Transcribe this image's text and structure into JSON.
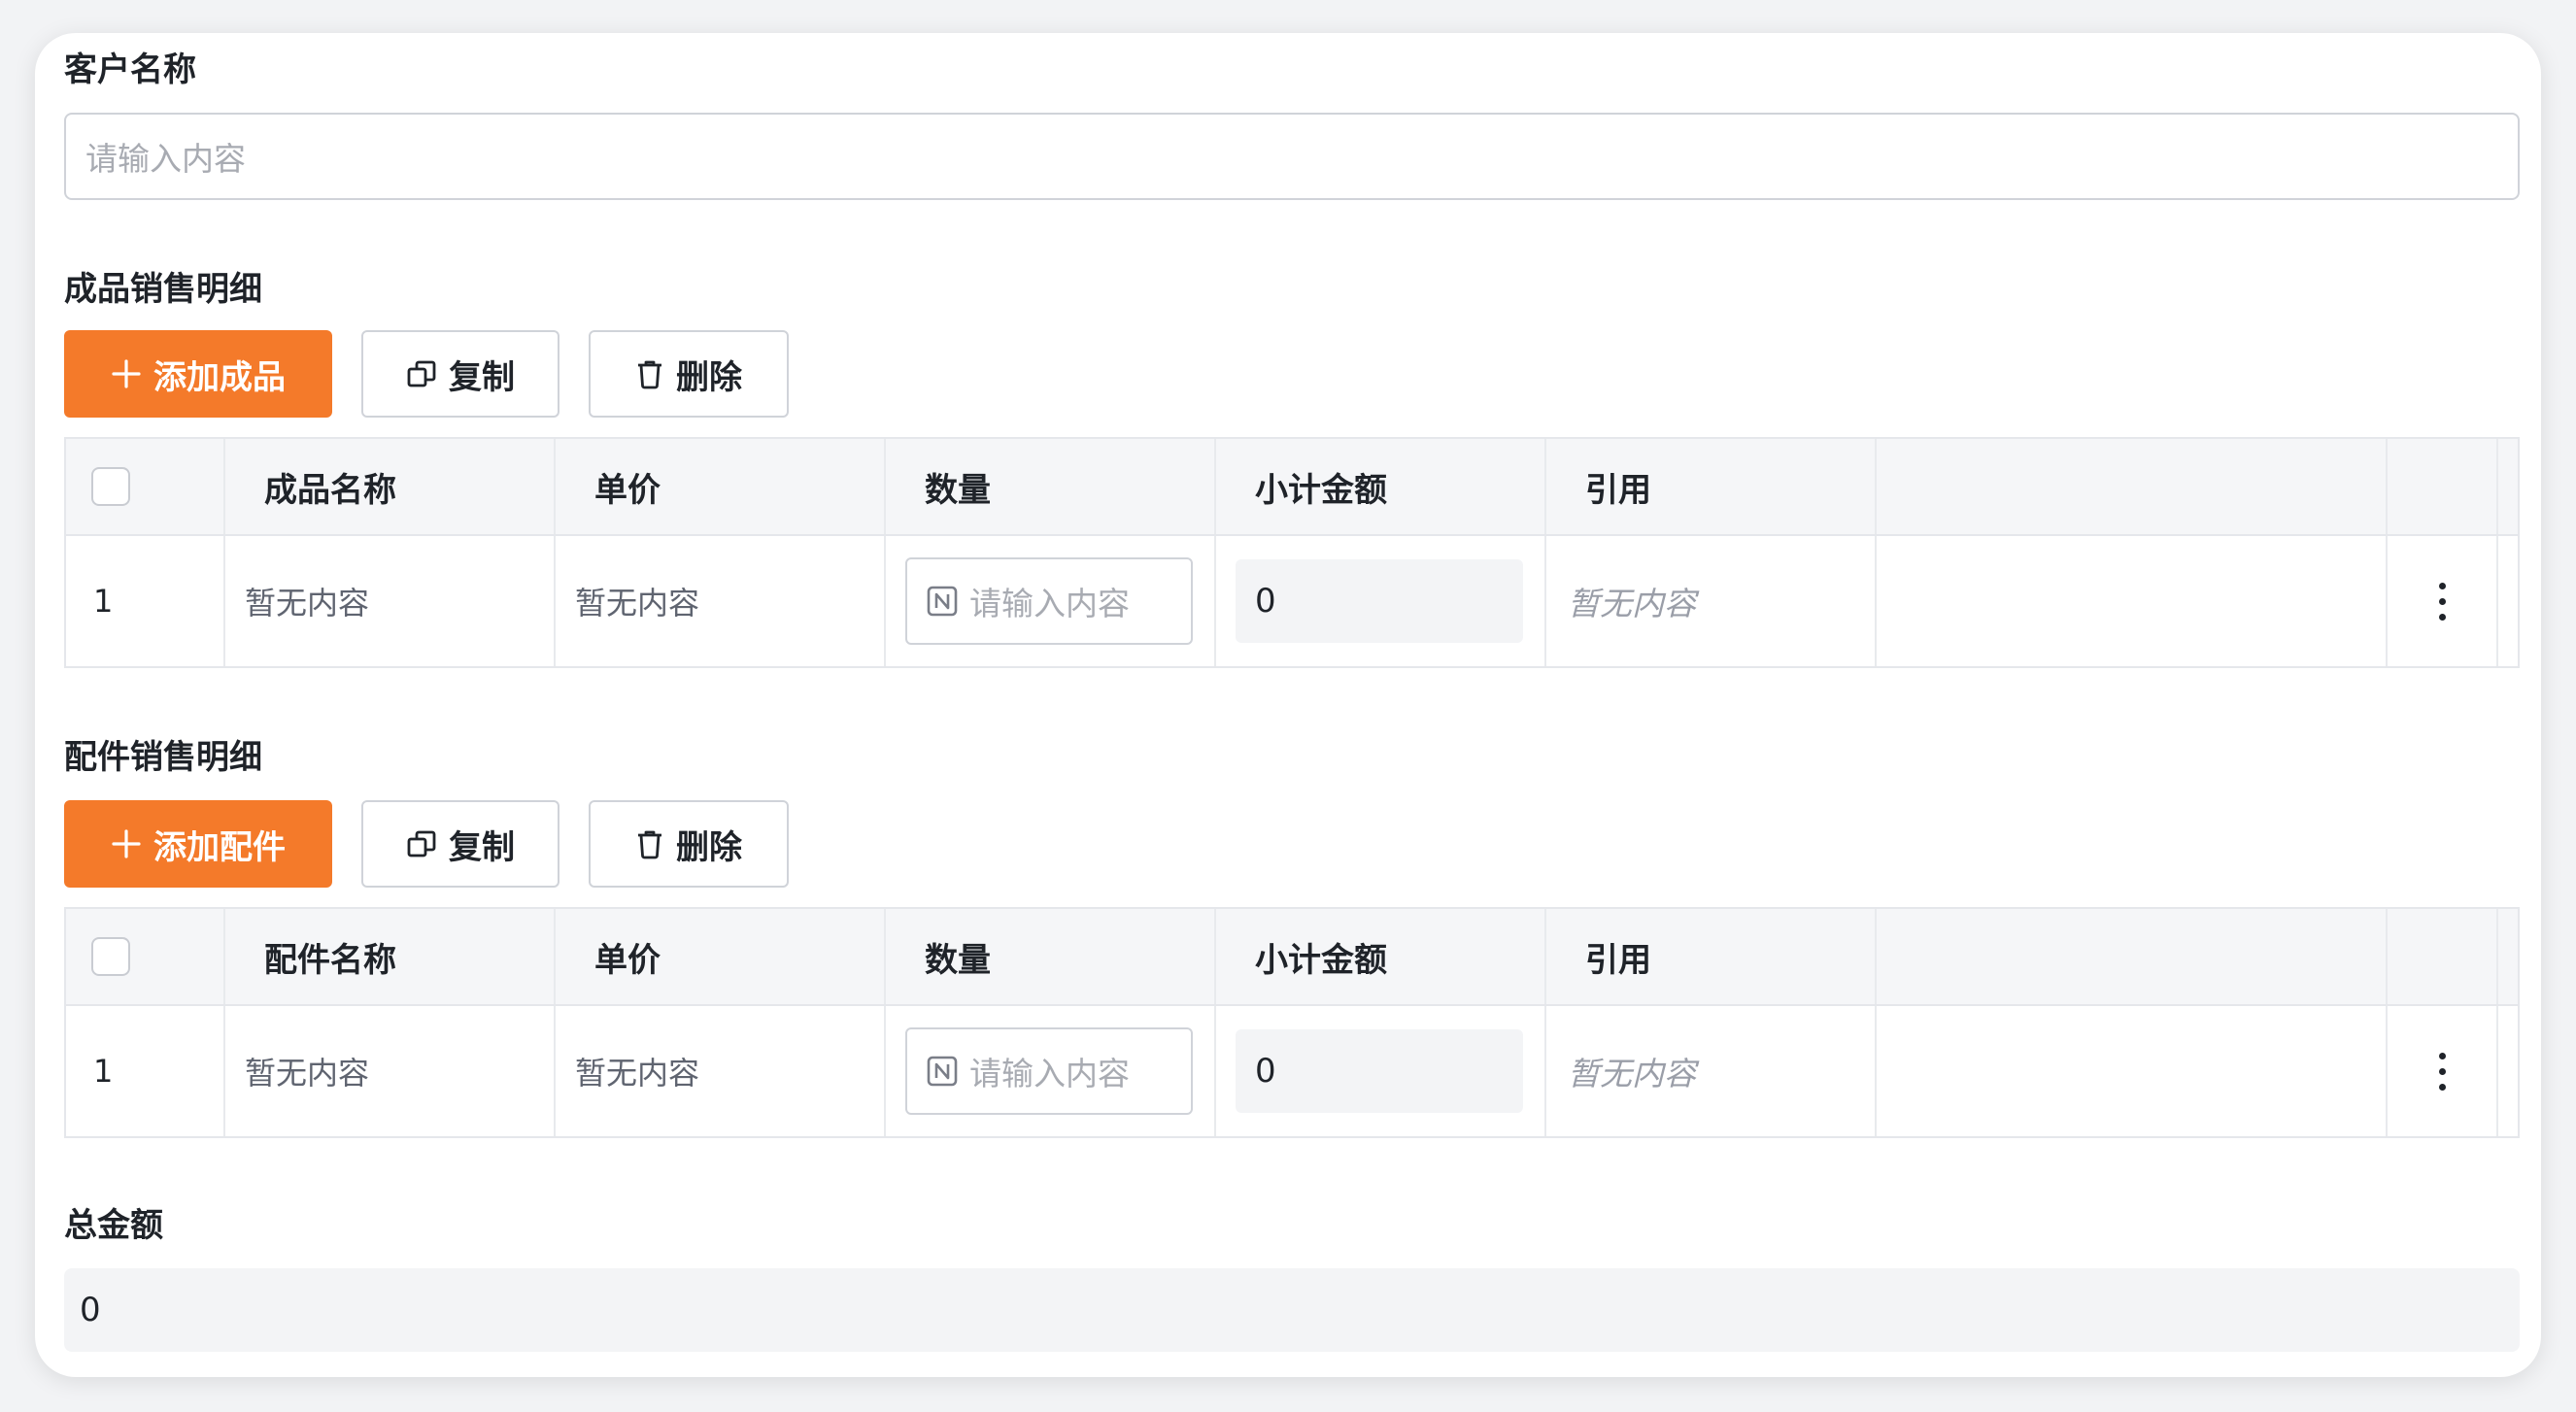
{
  "customer": {
    "label": "客户名称",
    "placeholder": "请输入内容"
  },
  "product_section": {
    "title": "成品销售明细",
    "add_label": "添加成品",
    "copy_label": "复制",
    "delete_label": "删除",
    "columns": [
      "成品名称",
      "单价",
      "数量",
      "小计金额",
      "引用"
    ],
    "row": {
      "index": "1",
      "name": "暂无内容",
      "price": "暂无内容",
      "qty_placeholder": "请输入内容",
      "subtotal": "0",
      "reference": "暂无内容"
    }
  },
  "parts_section": {
    "title": "配件销售明细",
    "add_label": "添加配件",
    "copy_label": "复制",
    "delete_label": "删除",
    "columns": [
      "配件名称",
      "单价",
      "数量",
      "小计金额",
      "引用"
    ],
    "row": {
      "index": "1",
      "name": "暂无内容",
      "price": "暂无内容",
      "qty_placeholder": "请输入内容",
      "subtotal": "0",
      "reference": "暂无内容"
    }
  },
  "total": {
    "label": "总金额",
    "value": "0"
  },
  "colors": {
    "primary": "#f47a2a",
    "border": "#d0d3d9",
    "header_bg": "#f5f6f8",
    "readonly_bg": "#f3f4f6"
  },
  "icons": {
    "add": "plus-icon",
    "copy": "copy-icon",
    "delete": "trash-icon",
    "number_field": "number-field-icon",
    "more": "more-vertical-icon"
  }
}
